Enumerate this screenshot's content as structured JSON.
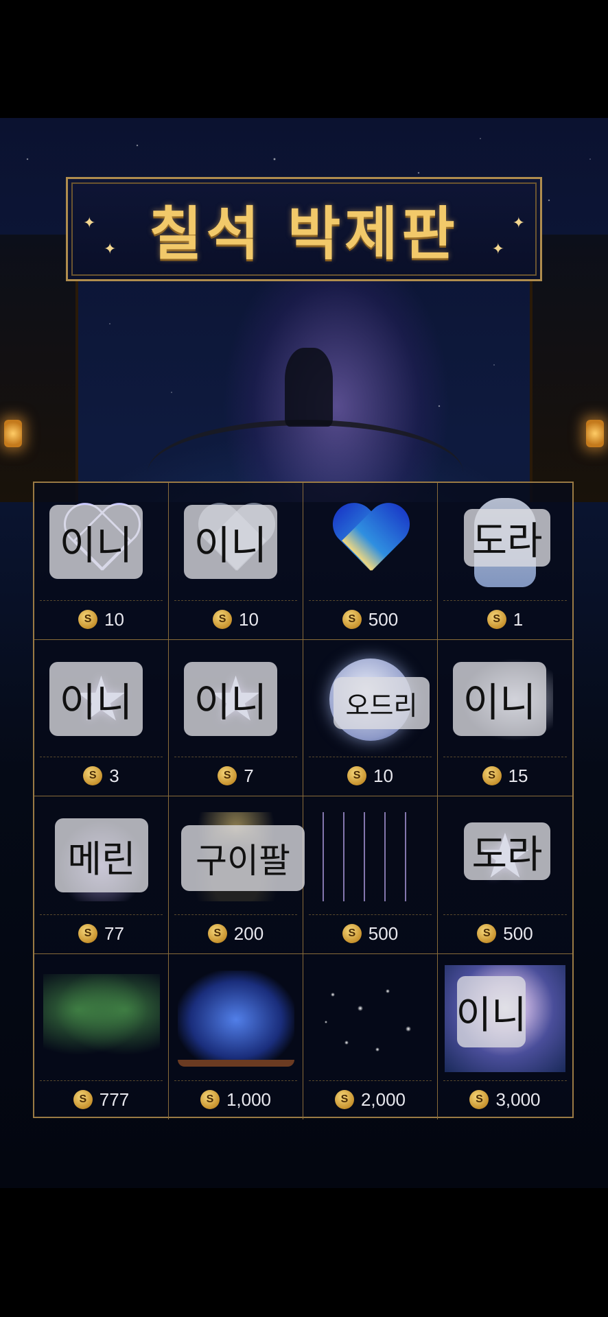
{
  "title": "칠석 박제판",
  "currency_symbol": "S",
  "items": [
    {
      "label": "이니",
      "price": "10"
    },
    {
      "label": "이니",
      "price": "10"
    },
    {
      "label": "",
      "price": "500"
    },
    {
      "label": "도라",
      "price": "1"
    },
    {
      "label": "이니",
      "price": "3"
    },
    {
      "label": "이니",
      "price": "7"
    },
    {
      "label": "오드리",
      "price": "10"
    },
    {
      "label": "이니",
      "price": "15"
    },
    {
      "label": "메린",
      "price": "77"
    },
    {
      "label": "구이팔",
      "price": "200"
    },
    {
      "label": "",
      "price": "500"
    },
    {
      "label": "도라",
      "price": "500"
    },
    {
      "label": "",
      "price": "777"
    },
    {
      "label": "",
      "price": "1,000"
    },
    {
      "label": "",
      "price": "2,000"
    },
    {
      "label": "이니",
      "price": "3,000"
    }
  ],
  "icons": [
    "glowing-heart-icon",
    "glass-heart-icon",
    "sky-lantern-heart-icon",
    "shaved-ice-icon",
    "star-charm-icon",
    "star-garland-icon",
    "moon-cloud-icon",
    "white-crane-icon",
    "crystal-orb-icon",
    "panda-fireworks-icon",
    "wind-chimes-icon",
    "star-frame-icon",
    "bamboo-tanabata-icon",
    "galaxy-book-icon",
    "constellation-icon",
    "moon-bridge-scene-icon"
  ],
  "colors": {
    "title_gold": "#f2c96a",
    "frame_gold": "#9a7a44",
    "coin_gold": "#c8932e",
    "night_blue": "#0b1230"
  }
}
